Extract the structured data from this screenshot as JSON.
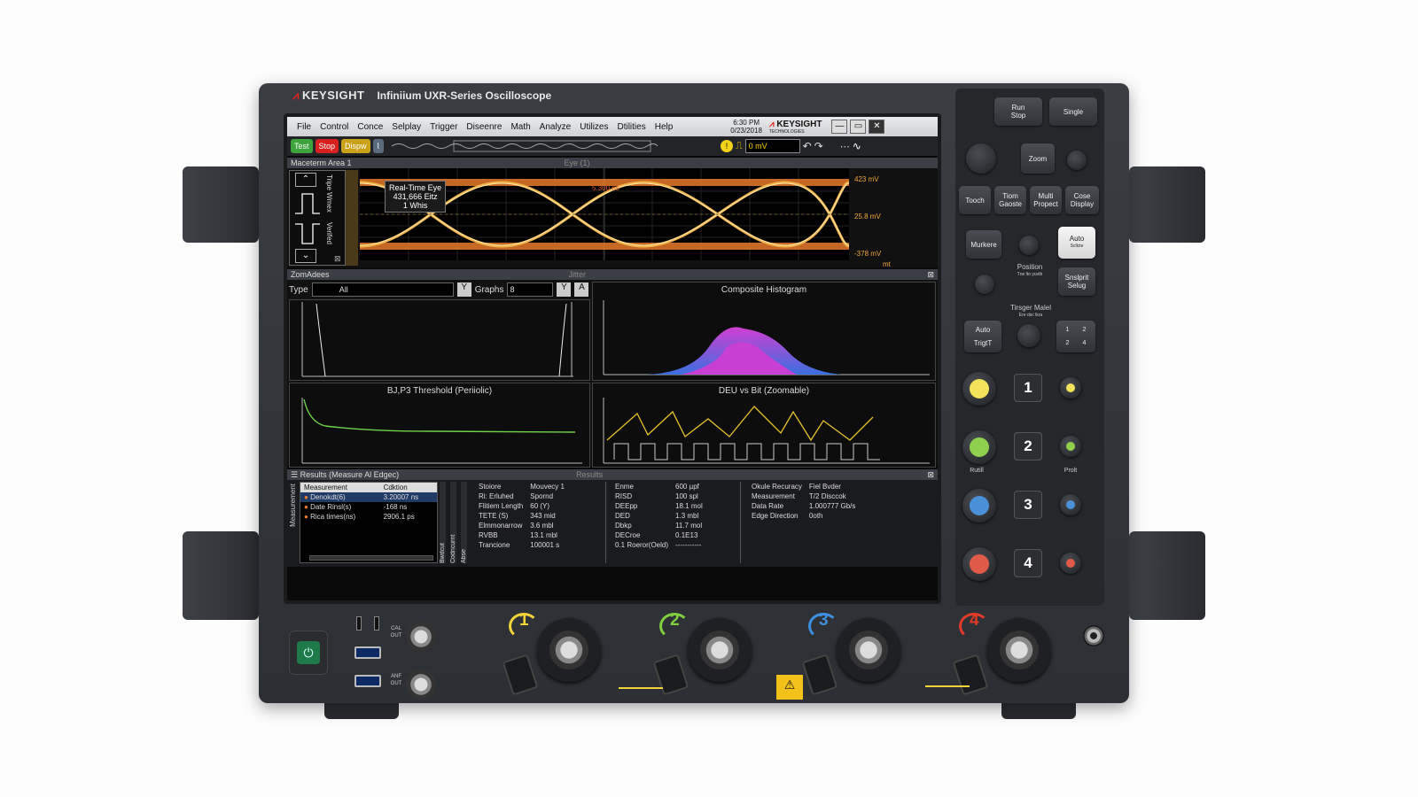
{
  "instrument": {
    "brand": "KEYSIGHT",
    "model": "Infiniium UXR-Series Oscilloscope"
  },
  "screen": {
    "menu": [
      "File",
      "Control",
      "Conce",
      "Selplay",
      "Trigger",
      "Diseenre",
      "Math",
      "Analyze",
      "Utilizes",
      "Dtilities",
      "Help"
    ],
    "time": "6:30 PM",
    "date": "0/23/2018",
    "logo": "KEYSIGHT",
    "logo_sub": "TECHNOLOGIES",
    "toolbar": {
      "test": "Test",
      "stop": "Stop",
      "disp": "Dispw",
      "voltage": "0 mV"
    },
    "eye_panel": {
      "title": "Maceterm Area 1",
      "tag": "Eye (1)",
      "side_label_1": "Tripe Wmex",
      "side_label_2": "Verifed",
      "info_line1": "Real-Time Eye",
      "info_line2": "431,666 Eitz",
      "info_line3": "1 Whis",
      "cursor_label": "5.300 ns",
      "scale_top": "423 mV",
      "scale_mid": "25.8 mV",
      "scale_bot": "-378 mV",
      "unit": "mt"
    },
    "analysis": {
      "title": "ZomAdees",
      "tag": "Jitter",
      "type_label": "Type",
      "type_value": "All",
      "graphs_label": "Graphs",
      "graphs_value": "8",
      "p2_title": "Composite Histogram",
      "p3_title": "BJ,P3 Threshold (Periiolic)",
      "p4_title": "DEU vs Bit (Zoomable)"
    },
    "results": {
      "title": "Results",
      "subtitle": "(Measure Al Edgec)",
      "tag": "Results",
      "side": "Measurement",
      "vtabs": [
        "Bwdcut",
        "Codncurnt",
        "Abse"
      ],
      "col_headers": [
        "Measurement",
        "Cdktion"
      ],
      "rows": [
        [
          "Denokdt(6)",
          "3.20007 ns"
        ],
        [
          "Date Rinsl(s)",
          "-168 ns"
        ],
        [
          "Rica times(ns)",
          "2906.1 ps"
        ]
      ],
      "col2": [
        [
          "Stoiore",
          "Mouvecy 1"
        ],
        [
          "Ri: Erluhed",
          "Spornd"
        ],
        [
          "Flitiem Length",
          "60 (Y)"
        ],
        [
          "TETE (S)",
          "343 mid"
        ],
        [
          "Elmmonarrow",
          "3.6 mbl"
        ],
        [
          "RVBB",
          "13.1 mbl"
        ],
        [
          "Trancione",
          "100001 s"
        ]
      ],
      "col3": [
        [
          "Enme",
          "600 µpf"
        ],
        [
          "RISD",
          "100 spl"
        ],
        [
          "DEEpp",
          "18.1 mol"
        ],
        [
          "DED",
          "1.3 mbl"
        ],
        [
          "Dbkp",
          "11.7 mol"
        ],
        [
          "DECroe",
          "0.1E13"
        ],
        [
          "0.1 Roeror(Oeld)",
          "-----------"
        ]
      ],
      "col4": [
        [
          "Okule Recuracy",
          "Fiel Bvder"
        ],
        [
          "Measurement",
          "T/2 Disccok"
        ],
        [
          "Data Rate",
          "1.000777 Gb/s"
        ],
        [
          "Edge Direction",
          "0oth"
        ]
      ]
    }
  },
  "front_panel": {
    "run_stop": "Run\nStop",
    "single": "Single",
    "zoom": "Zoom",
    "touch": "Tooch",
    "tiom_gaoste": "Tiom Gaoste",
    "multi_propect": "Multi Propect",
    "cose_display": "Cose Display",
    "markers": "Murkere",
    "auto_scale": "Auto",
    "auto_scale_sub": "Scllcte",
    "position": "Position",
    "position_sub": "Tne lto yuvtb",
    "snglprit": "Snslprit Selug",
    "trigger_menu": "Tirsger Malel",
    "trigger_sub": "Ere dsc lkra",
    "auto": "Auto",
    "trig": "TrigtT",
    "modes": [
      "1",
      "2",
      "2",
      "4"
    ],
    "channels": [
      "1",
      "2",
      "3",
      "4"
    ],
    "ch_colors": [
      "#f2e35a",
      "#8fd14f",
      "#4a90d9",
      "#e05a4a"
    ],
    "small_label_1": "Rutill",
    "small_label_2": "Prolt"
  },
  "io": {
    "cal_out": "CAL OUT",
    "aux_out": "ANF OUT",
    "inputs": [
      "1",
      "2",
      "3",
      "4"
    ],
    "input_colors": [
      "#f2d43a",
      "#7fcf3f",
      "#3f8fe0",
      "#e03a2a"
    ],
    "warning": "⚠"
  }
}
